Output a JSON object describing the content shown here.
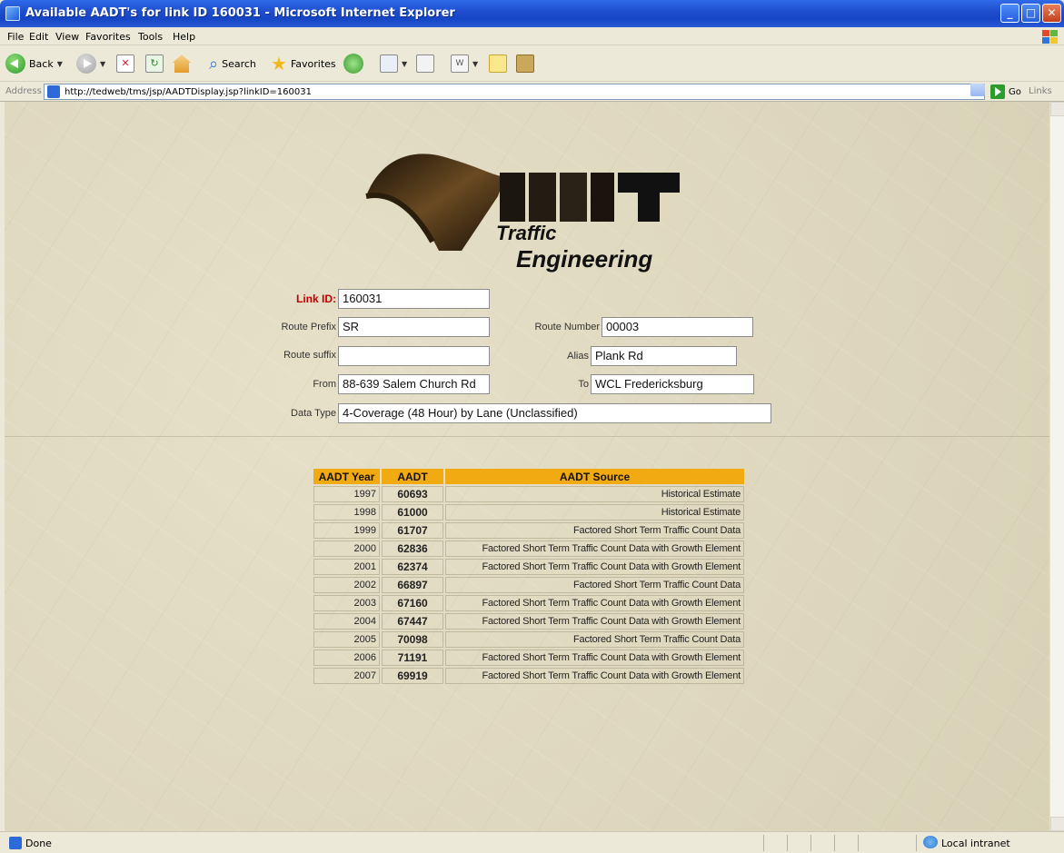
{
  "window": {
    "title": "Available AADT's for link ID 160031 - Microsoft Internet Explorer"
  },
  "menu": [
    "File",
    "Edit",
    "View",
    "Favorites",
    "Tools",
    "Help"
  ],
  "toolbar": {
    "back_label": "Back",
    "search_label": "Search",
    "favorites_label": "Favorites"
  },
  "address": {
    "label": "Address",
    "url": "http://tedweb/tms/jsp/AADTDisplay.jsp?linkID=160031",
    "go_label": "Go",
    "links_label": "Links"
  },
  "logo": {
    "line1": "Traffic",
    "line2": "Engineering"
  },
  "form": {
    "link_id_label": "Link ID:",
    "link_id": "160031",
    "route_prefix_label": "Route Prefix",
    "route_prefix": "SR",
    "route_number_label": "Route Number",
    "route_number": "00003",
    "route_suffix_label": "Route suffix",
    "route_suffix": "",
    "alias_label": "Alias",
    "alias": "Plank Rd",
    "from_label": "From",
    "from": "88-639 Salem Church Rd",
    "to_label": "To",
    "to": "WCL Fredericksburg",
    "data_type_label": "Data Type",
    "data_type": "4-Coverage (48 Hour) by Lane (Unclassified)"
  },
  "table": {
    "headers": [
      "AADT Year",
      "AADT",
      "AADT Source"
    ],
    "rows": [
      {
        "year": "1997",
        "aadt": "60693",
        "source": "Historical Estimate"
      },
      {
        "year": "1998",
        "aadt": "61000",
        "source": "Historical Estimate"
      },
      {
        "year": "1999",
        "aadt": "61707",
        "source": "Factored Short Term Traffic Count Data"
      },
      {
        "year": "2000",
        "aadt": "62836",
        "source": "Factored Short Term Traffic Count Data with Growth Element"
      },
      {
        "year": "2001",
        "aadt": "62374",
        "source": "Factored Short Term Traffic Count Data with Growth Element"
      },
      {
        "year": "2002",
        "aadt": "66897",
        "source": "Factored Short Term Traffic Count Data"
      },
      {
        "year": "2003",
        "aadt": "67160",
        "source": "Factored Short Term Traffic Count Data with Growth Element"
      },
      {
        "year": "2004",
        "aadt": "67447",
        "source": "Factored Short Term Traffic Count Data with Growth Element"
      },
      {
        "year": "2005",
        "aadt": "70098",
        "source": "Factored Short Term Traffic Count Data"
      },
      {
        "year": "2006",
        "aadt": "71191",
        "source": "Factored Short Term Traffic Count Data with Growth Element"
      },
      {
        "year": "2007",
        "aadt": "69919",
        "source": "Factored Short Term Traffic Count Data with Growth Element"
      }
    ]
  },
  "status": {
    "text": "Done",
    "zone": "Local intranet"
  },
  "colors": {
    "header_bg": "#f2aa12",
    "link_id_label": "#c00000",
    "titlebar": "#1f4fcf"
  },
  "icons": [
    "ie-page-icon",
    "back-icon",
    "forward-icon",
    "stop-icon",
    "refresh-icon",
    "home-icon",
    "search-icon",
    "favorites-icon",
    "history-icon",
    "mail-icon",
    "print-icon",
    "edit-icon",
    "folder-icon",
    "go-arrow-icon"
  ]
}
